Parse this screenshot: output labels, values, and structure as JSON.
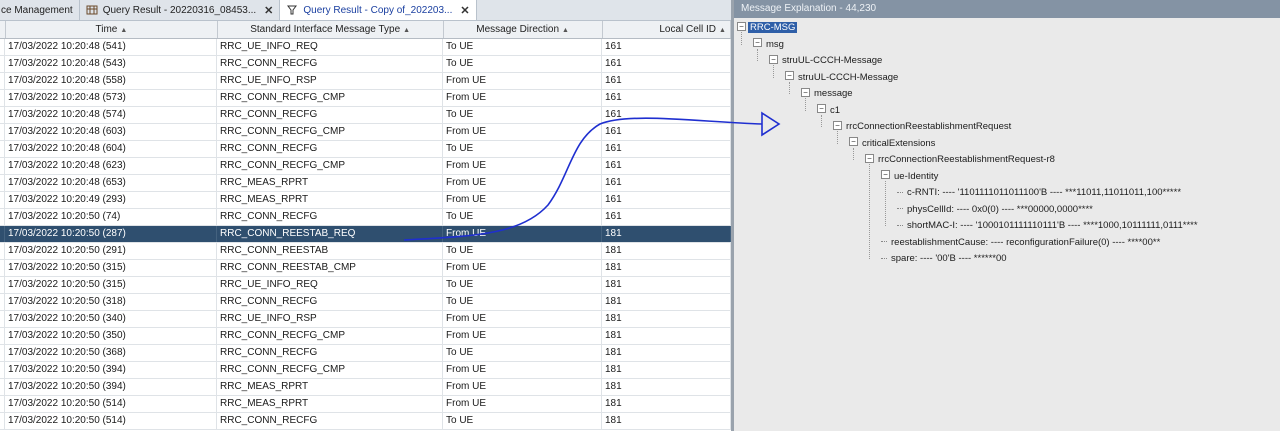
{
  "tabs": [
    {
      "label": "ce Management",
      "icon": "management-icon",
      "active": false,
      "closable": false
    },
    {
      "label": "Query Result - 20220316_08453...",
      "icon": "table-icon",
      "active": false,
      "closable": true
    },
    {
      "label": "Query Result - Copy of_202203...",
      "icon": "query-icon",
      "active": true,
      "closable": true
    }
  ],
  "table": {
    "headers": [
      "Time",
      "Standard Interface Message Type",
      "Message Direction",
      "Local Cell ID"
    ],
    "selected_index": 12,
    "rows": [
      [
        "17/03/2022 10:20:48 (541)",
        "RRC_UE_INFO_REQ",
        "To UE",
        "161"
      ],
      [
        "17/03/2022 10:20:48 (543)",
        "RRC_CONN_RECFG",
        "To UE",
        "161"
      ],
      [
        "17/03/2022 10:20:48 (558)",
        "RRC_UE_INFO_RSP",
        "From UE",
        "161"
      ],
      [
        "17/03/2022 10:20:48 (573)",
        "RRC_CONN_RECFG_CMP",
        "From UE",
        "161"
      ],
      [
        "17/03/2022 10:20:48 (574)",
        "RRC_CONN_RECFG",
        "To UE",
        "161"
      ],
      [
        "17/03/2022 10:20:48 (603)",
        "RRC_CONN_RECFG_CMP",
        "From UE",
        "161"
      ],
      [
        "17/03/2022 10:20:48 (604)",
        "RRC_CONN_RECFG",
        "To UE",
        "161"
      ],
      [
        "17/03/2022 10:20:48 (623)",
        "RRC_CONN_RECFG_CMP",
        "From UE",
        "161"
      ],
      [
        "17/03/2022 10:20:48 (653)",
        "RRC_MEAS_RPRT",
        "From UE",
        "161"
      ],
      [
        "17/03/2022 10:20:49 (293)",
        "RRC_MEAS_RPRT",
        "From UE",
        "161"
      ],
      [
        "17/03/2022 10:20:50 (74)",
        "RRC_CONN_RECFG",
        "To UE",
        "161"
      ],
      [
        "17/03/2022 10:20:50 (287)",
        "RRC_CONN_REESTAB_REQ",
        "From UE",
        "181"
      ],
      [
        "17/03/2022 10:20:50 (287)",
        "RRC_CONN_REESTAB_REQ",
        "From UE",
        "181"
      ],
      [
        "17/03/2022 10:20:50 (291)",
        "RRC_CONN_REESTAB",
        "To UE",
        "181"
      ],
      [
        "17/03/2022 10:20:50 (315)",
        "RRC_CONN_REESTAB_CMP",
        "From UE",
        "181"
      ],
      [
        "17/03/2022 10:20:50 (315)",
        "RRC_UE_INFO_REQ",
        "To UE",
        "181"
      ],
      [
        "17/03/2022 10:20:50 (318)",
        "RRC_CONN_RECFG",
        "To UE",
        "181"
      ],
      [
        "17/03/2022 10:20:50 (340)",
        "RRC_UE_INFO_RSP",
        "From UE",
        "181"
      ],
      [
        "17/03/2022 10:20:50 (350)",
        "RRC_CONN_RECFG_CMP",
        "From UE",
        "181"
      ],
      [
        "17/03/2022 10:20:50 (368)",
        "RRC_CONN_RECFG",
        "To UE",
        "181"
      ],
      [
        "17/03/2022 10:20:50 (394)",
        "RRC_CONN_RECFG_CMP",
        "From UE",
        "181"
      ],
      [
        "17/03/2022 10:20:50 (394)",
        "RRC_MEAS_RPRT",
        "From UE",
        "181"
      ],
      [
        "17/03/2022 10:20:50 (514)",
        "RRC_MEAS_RPRT",
        "From UE",
        "181"
      ],
      [
        "17/03/2022 10:20:50 (514)",
        "RRC_CONN_RECFG",
        "To UE",
        "181"
      ]
    ]
  },
  "explanation": {
    "title": "Message Explanation - 44,230",
    "nodes": [
      {
        "label": "RRC-MSG",
        "depth": 0,
        "type": "expanded",
        "highlight": true
      },
      {
        "label": "msg",
        "depth": 1,
        "type": "expanded"
      },
      {
        "label": "struUL-CCCH-Message",
        "depth": 2,
        "type": "expanded"
      },
      {
        "label": "struUL-CCCH-Message",
        "depth": 3,
        "type": "expanded"
      },
      {
        "label": "message",
        "depth": 4,
        "type": "expanded"
      },
      {
        "label": "c1",
        "depth": 5,
        "type": "expanded"
      },
      {
        "label": "rrcConnectionReestablishmentRequest",
        "depth": 6,
        "type": "expanded"
      },
      {
        "label": "criticalExtensions",
        "depth": 7,
        "type": "expanded"
      },
      {
        "label": "rrcConnectionReestablishmentRequest-r8",
        "depth": 8,
        "type": "expanded"
      },
      {
        "label": "ue-Identity",
        "depth": 9,
        "type": "expanded"
      },
      {
        "label": "c-RNTI: ---- '1101111011011100'B ---- ***11011,11011011,100*****",
        "depth": 10,
        "type": "leaf"
      },
      {
        "label": "physCellId: ---- 0x0(0) ---- ***00000,0000****",
        "depth": 10,
        "type": "leaf"
      },
      {
        "label": "shortMAC-I: ---- '1000101111110111'B ---- ****1000,10111111,0111****",
        "depth": 10,
        "type": "leaf"
      },
      {
        "label": "reestablishmentCause: ---- reconfigurationFailure(0) ---- ****00**",
        "depth": 9,
        "type": "leaf"
      },
      {
        "label": "spare: ---- '00'B ---- ******00",
        "depth": 9,
        "type": "leaf"
      }
    ]
  },
  "colors": {
    "selection": "#2f4f6f",
    "annotation_stroke": "#1f2fd0",
    "tree_highlight": "#2f5fa8"
  }
}
